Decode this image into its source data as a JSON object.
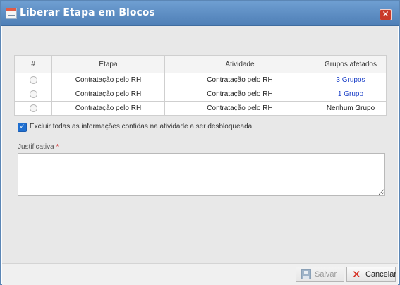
{
  "window": {
    "title": "Liberar Etapa em Blocos",
    "close_symbol": "✕"
  },
  "table": {
    "headers": [
      "#",
      "Etapa",
      "Atividade",
      "Grupos afetados"
    ],
    "rows": [
      {
        "etapa": "Contratação pelo RH",
        "atividade": "Contratação pelo RH",
        "grupos": "3 Grupos",
        "grupos_is_link": true
      },
      {
        "etapa": "Contratação pelo RH",
        "atividade": "Contratação pelo RH",
        "grupos": "1 Grupo",
        "grupos_is_link": true
      },
      {
        "etapa": "Contratação pelo RH",
        "atividade": "Contratação pelo RH",
        "grupos": "Nenhum Grupo",
        "grupos_is_link": false
      }
    ]
  },
  "options": {
    "excluir_checked": true,
    "excluir_label": "Excluir todas as informações contidas na atividade a ser desbloqueada"
  },
  "form": {
    "justificativa_label": "Justificativa",
    "required_marker": "*",
    "justificativa_value": ""
  },
  "footer": {
    "save_label": "Salvar",
    "save_enabled": false,
    "cancel_label": "Cancelar"
  },
  "icons": {
    "window": "form-icon",
    "close": "close-icon",
    "save": "floppy-disk-icon",
    "cancel": "x-icon"
  },
  "colors": {
    "titlebar": "#4f7fb6",
    "close_button": "#c93a2a",
    "link": "#1a3fc7",
    "required": "#d12a2a",
    "checkbox": "#1f6fd0"
  }
}
